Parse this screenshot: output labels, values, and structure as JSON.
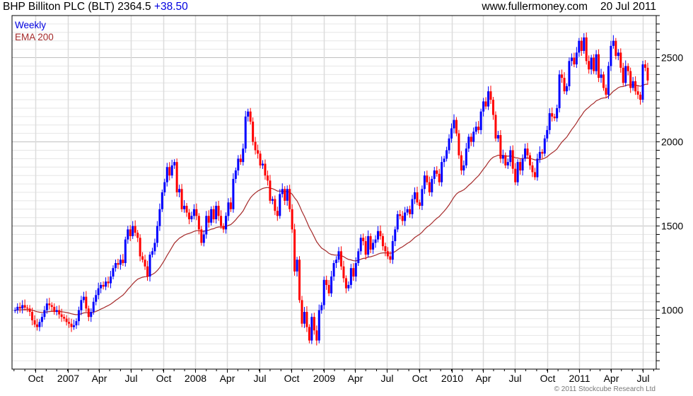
{
  "header": {
    "title": "BHP Billiton PLC (BLT) 2364.5",
    "change": "+38.50",
    "site": "www.fullermoney.com",
    "date": "20 Jul 2011"
  },
  "legend": {
    "period": "Weekly",
    "indicator": "EMA 200"
  },
  "footer": "© 2011 Stockcube Research Ltd",
  "colors": {
    "up": "#0000ff",
    "down": "#ff0000",
    "ema": "#a52a2a",
    "change": "#0000e0"
  },
  "chart_data": {
    "type": "candlestick",
    "title": "BHP Billiton PLC (BLT) 2364.5",
    "period": "Weekly",
    "overlay": "EMA 200",
    "ylim": [
      650,
      2750
    ],
    "y_ticks": [
      1000,
      1500,
      2000,
      2500
    ],
    "y_axis": "right",
    "grid": true,
    "x_ticks": [
      {
        "label": "Oct",
        "date": "2006-10-01"
      },
      {
        "label": "2007",
        "date": "2007-01-01"
      },
      {
        "label": "Apr",
        "date": "2007-04-01"
      },
      {
        "label": "Jul",
        "date": "2007-07-01"
      },
      {
        "label": "Oct",
        "date": "2007-10-01"
      },
      {
        "label": "2008",
        "date": "2008-01-01"
      },
      {
        "label": "Apr",
        "date": "2008-04-01"
      },
      {
        "label": "Jul",
        "date": "2008-07-01"
      },
      {
        "label": "Oct",
        "date": "2008-10-01"
      },
      {
        "label": "2009",
        "date": "2009-01-01"
      },
      {
        "label": "Apr",
        "date": "2009-04-01"
      },
      {
        "label": "Jul",
        "date": "2009-07-01"
      },
      {
        "label": "Oct",
        "date": "2009-10-01"
      },
      {
        "label": "2010",
        "date": "2010-01-01"
      },
      {
        "label": "Apr",
        "date": "2010-04-01"
      },
      {
        "label": "Jul",
        "date": "2010-07-01"
      },
      {
        "label": "Oct",
        "date": "2010-10-01"
      },
      {
        "label": "2011",
        "date": "2011-01-01"
      },
      {
        "label": "Apr",
        "date": "2011-04-01"
      },
      {
        "label": "Jul",
        "date": "2011-07-01"
      }
    ],
    "weekly_close": [
      [
        "2006-08-04",
        1000
      ],
      [
        "2006-08-11",
        1020
      ],
      [
        "2006-08-18",
        1010
      ],
      [
        "2006-08-25",
        1030
      ],
      [
        "2006-09-01",
        1015
      ],
      [
        "2006-09-08",
        1010
      ],
      [
        "2006-09-15",
        990
      ],
      [
        "2006-09-22",
        940
      ],
      [
        "2006-09-29",
        915
      ],
      [
        "2006-10-06",
        900
      ],
      [
        "2006-10-13",
        930
      ],
      [
        "2006-10-20",
        960
      ],
      [
        "2006-10-27",
        1000
      ],
      [
        "2006-11-03",
        1040
      ],
      [
        "2006-11-10",
        1030
      ],
      [
        "2006-11-17",
        1020
      ],
      [
        "2006-11-24",
        990
      ],
      [
        "2006-12-01",
        1000
      ],
      [
        "2006-12-08",
        975
      ],
      [
        "2006-12-15",
        960
      ],
      [
        "2006-12-22",
        950
      ],
      [
        "2006-12-29",
        930
      ],
      [
        "2007-01-05",
        920
      ],
      [
        "2007-01-12",
        900
      ],
      [
        "2007-01-19",
        910
      ],
      [
        "2007-01-26",
        935
      ],
      [
        "2007-02-02",
        1000
      ],
      [
        "2007-02-09",
        1060
      ],
      [
        "2007-02-16",
        1080
      ],
      [
        "2007-02-23",
        1010
      ],
      [
        "2007-03-02",
        960
      ],
      [
        "2007-03-09",
        990
      ],
      [
        "2007-03-16",
        1050
      ],
      [
        "2007-03-23",
        1090
      ],
      [
        "2007-03-30",
        1130
      ],
      [
        "2007-04-06",
        1150
      ],
      [
        "2007-04-13",
        1140
      ],
      [
        "2007-04-20",
        1170
      ],
      [
        "2007-04-27",
        1160
      ],
      [
        "2007-05-04",
        1200
      ],
      [
        "2007-05-11",
        1250
      ],
      [
        "2007-05-18",
        1280
      ],
      [
        "2007-05-25",
        1270
      ],
      [
        "2007-06-01",
        1300
      ],
      [
        "2007-06-08",
        1280
      ],
      [
        "2007-06-15",
        1420
      ],
      [
        "2007-06-22",
        1480
      ],
      [
        "2007-06-29",
        1440
      ],
      [
        "2007-07-06",
        1500
      ],
      [
        "2007-07-13",
        1460
      ],
      [
        "2007-07-20",
        1430
      ],
      [
        "2007-07-27",
        1320
      ],
      [
        "2007-08-03",
        1300
      ],
      [
        "2007-08-10",
        1260
      ],
      [
        "2007-08-17",
        1200
      ],
      [
        "2007-08-24",
        1330
      ],
      [
        "2007-08-31",
        1350
      ],
      [
        "2007-09-07",
        1400
      ],
      [
        "2007-09-14",
        1500
      ],
      [
        "2007-09-21",
        1600
      ],
      [
        "2007-09-28",
        1700
      ],
      [
        "2007-10-05",
        1760
      ],
      [
        "2007-10-12",
        1850
      ],
      [
        "2007-10-19",
        1800
      ],
      [
        "2007-10-26",
        1860
      ],
      [
        "2007-11-02",
        1880
      ],
      [
        "2007-11-09",
        1700
      ],
      [
        "2007-11-16",
        1720
      ],
      [
        "2007-11-23",
        1600
      ],
      [
        "2007-11-30",
        1620
      ],
      [
        "2007-12-07",
        1580
      ],
      [
        "2007-12-14",
        1540
      ],
      [
        "2007-12-21",
        1560
      ],
      [
        "2007-12-28",
        1600
      ],
      [
        "2008-01-04",
        1560
      ],
      [
        "2008-01-11",
        1480
      ],
      [
        "2008-01-18",
        1400
      ],
      [
        "2008-01-25",
        1450
      ],
      [
        "2008-02-01",
        1560
      ],
      [
        "2008-02-08",
        1520
      ],
      [
        "2008-02-15",
        1600
      ],
      [
        "2008-02-22",
        1540
      ],
      [
        "2008-02-29",
        1620
      ],
      [
        "2008-03-07",
        1560
      ],
      [
        "2008-03-14",
        1500
      ],
      [
        "2008-03-21",
        1480
      ],
      [
        "2008-03-28",
        1560
      ],
      [
        "2008-04-04",
        1640
      ],
      [
        "2008-04-11",
        1600
      ],
      [
        "2008-04-18",
        1780
      ],
      [
        "2008-04-25",
        1830
      ],
      [
        "2008-05-02",
        1900
      ],
      [
        "2008-05-09",
        1880
      ],
      [
        "2008-05-16",
        1960
      ],
      [
        "2008-05-23",
        2150
      ],
      [
        "2008-05-30",
        2180
      ],
      [
        "2008-06-06",
        2120
      ],
      [
        "2008-06-13",
        2000
      ],
      [
        "2008-06-20",
        1950
      ],
      [
        "2008-06-27",
        1930
      ],
      [
        "2008-07-04",
        1860
      ],
      [
        "2008-07-11",
        1870
      ],
      [
        "2008-07-18",
        1800
      ],
      [
        "2008-07-25",
        1770
      ],
      [
        "2008-08-01",
        1650
      ],
      [
        "2008-08-08",
        1660
      ],
      [
        "2008-08-15",
        1590
      ],
      [
        "2008-08-22",
        1560
      ],
      [
        "2008-08-29",
        1690
      ],
      [
        "2008-09-05",
        1720
      ],
      [
        "2008-09-12",
        1650
      ],
      [
        "2008-09-19",
        1720
      ],
      [
        "2008-09-26",
        1600
      ],
      [
        "2008-10-03",
        1480
      ],
      [
        "2008-10-10",
        1230
      ],
      [
        "2008-10-17",
        1300
      ],
      [
        "2008-10-24",
        1060
      ],
      [
        "2008-10-31",
        920
      ],
      [
        "2008-11-07",
        990
      ],
      [
        "2008-11-14",
        900
      ],
      [
        "2008-11-21",
        820
      ],
      [
        "2008-11-28",
        960
      ],
      [
        "2008-12-05",
        880
      ],
      [
        "2008-12-12",
        820
      ],
      [
        "2008-12-19",
        1000
      ],
      [
        "2008-12-26",
        1030
      ],
      [
        "2009-01-02",
        1180
      ],
      [
        "2009-01-09",
        1150
      ],
      [
        "2009-01-16",
        1100
      ],
      [
        "2009-01-23",
        1200
      ],
      [
        "2009-01-30",
        1280
      ],
      [
        "2009-02-06",
        1300
      ],
      [
        "2009-02-13",
        1350
      ],
      [
        "2009-02-20",
        1260
      ],
      [
        "2009-02-27",
        1190
      ],
      [
        "2009-03-06",
        1130
      ],
      [
        "2009-03-13",
        1150
      ],
      [
        "2009-03-20",
        1250
      ],
      [
        "2009-03-27",
        1200
      ],
      [
        "2009-04-03",
        1280
      ],
      [
        "2009-04-10",
        1350
      ],
      [
        "2009-04-17",
        1430
      ],
      [
        "2009-04-24",
        1410
      ],
      [
        "2009-05-01",
        1330
      ],
      [
        "2009-05-08",
        1440
      ],
      [
        "2009-05-15",
        1360
      ],
      [
        "2009-05-22",
        1400
      ],
      [
        "2009-05-29",
        1420
      ],
      [
        "2009-06-05",
        1470
      ],
      [
        "2009-06-12",
        1440
      ],
      [
        "2009-06-19",
        1380
      ],
      [
        "2009-06-26",
        1350
      ],
      [
        "2009-07-03",
        1320
      ],
      [
        "2009-07-10",
        1300
      ],
      [
        "2009-07-17",
        1410
      ],
      [
        "2009-07-24",
        1480
      ],
      [
        "2009-07-31",
        1570
      ],
      [
        "2009-08-07",
        1560
      ],
      [
        "2009-08-14",
        1530
      ],
      [
        "2009-08-21",
        1580
      ],
      [
        "2009-08-28",
        1600
      ],
      [
        "2009-09-04",
        1570
      ],
      [
        "2009-09-11",
        1660
      ],
      [
        "2009-09-18",
        1700
      ],
      [
        "2009-09-25",
        1640
      ],
      [
        "2009-10-02",
        1620
      ],
      [
        "2009-10-09",
        1720
      ],
      [
        "2009-10-16",
        1800
      ],
      [
        "2009-10-23",
        1760
      ],
      [
        "2009-10-30",
        1700
      ],
      [
        "2009-11-06",
        1780
      ],
      [
        "2009-11-13",
        1830
      ],
      [
        "2009-11-20",
        1810
      ],
      [
        "2009-11-27",
        1760
      ],
      [
        "2009-12-04",
        1880
      ],
      [
        "2009-12-11",
        1900
      ],
      [
        "2009-12-18",
        1950
      ],
      [
        "2009-12-25",
        2020
      ],
      [
        "2010-01-01",
        2080
      ],
      [
        "2010-01-08",
        2130
      ],
      [
        "2010-01-15",
        2050
      ],
      [
        "2010-01-22",
        1920
      ],
      [
        "2010-01-29",
        1830
      ],
      [
        "2010-02-05",
        1860
      ],
      [
        "2010-02-12",
        1960
      ],
      [
        "2010-02-19",
        2030
      ],
      [
        "2010-02-26",
        2000
      ],
      [
        "2010-03-05",
        2060
      ],
      [
        "2010-03-12",
        2090
      ],
      [
        "2010-03-19",
        2070
      ],
      [
        "2010-03-26",
        2180
      ],
      [
        "2010-04-02",
        2240
      ],
      [
        "2010-04-09",
        2210
      ],
      [
        "2010-04-16",
        2300
      ],
      [
        "2010-04-23",
        2250
      ],
      [
        "2010-04-30",
        2160
      ],
      [
        "2010-05-07",
        2020
      ],
      [
        "2010-05-14",
        2040
      ],
      [
        "2010-05-21",
        1900
      ],
      [
        "2010-05-28",
        1920
      ],
      [
        "2010-06-04",
        1860
      ],
      [
        "2010-06-11",
        1880
      ],
      [
        "2010-06-18",
        1950
      ],
      [
        "2010-06-25",
        1840
      ],
      [
        "2010-07-02",
        1760
      ],
      [
        "2010-07-09",
        1880
      ],
      [
        "2010-07-16",
        1830
      ],
      [
        "2010-07-23",
        1900
      ],
      [
        "2010-07-30",
        1960
      ],
      [
        "2010-08-06",
        1920
      ],
      [
        "2010-08-13",
        1860
      ],
      [
        "2010-08-20",
        1820
      ],
      [
        "2010-08-27",
        1790
      ],
      [
        "2010-09-03",
        1900
      ],
      [
        "2010-09-10",
        1940
      ],
      [
        "2010-09-17",
        1930
      ],
      [
        "2010-09-24",
        2020
      ],
      [
        "2010-10-01",
        2070
      ],
      [
        "2010-10-08",
        2170
      ],
      [
        "2010-10-15",
        2150
      ],
      [
        "2010-10-22",
        2140
      ],
      [
        "2010-10-29",
        2200
      ],
      [
        "2010-11-05",
        2400
      ],
      [
        "2010-11-12",
        2380
      ],
      [
        "2010-11-19",
        2300
      ],
      [
        "2010-11-26",
        2330
      ],
      [
        "2010-12-03",
        2480
      ],
      [
        "2010-12-10",
        2500
      ],
      [
        "2010-12-17",
        2460
      ],
      [
        "2010-12-24",
        2530
      ],
      [
        "2010-12-31",
        2600
      ],
      [
        "2011-01-07",
        2540
      ],
      [
        "2011-01-14",
        2620
      ],
      [
        "2011-01-21",
        2480
      ],
      [
        "2011-01-28",
        2430
      ],
      [
        "2011-02-04",
        2500
      ],
      [
        "2011-02-11",
        2420
      ],
      [
        "2011-02-18",
        2520
      ],
      [
        "2011-02-25",
        2380
      ],
      [
        "2011-03-04",
        2400
      ],
      [
        "2011-03-11",
        2320
      ],
      [
        "2011-03-18",
        2280
      ],
      [
        "2011-03-25",
        2450
      ],
      [
        "2011-04-01",
        2570
      ],
      [
        "2011-04-08",
        2600
      ],
      [
        "2011-04-15",
        2510
      ],
      [
        "2011-04-22",
        2530
      ],
      [
        "2011-04-29",
        2440
      ],
      [
        "2011-05-06",
        2350
      ],
      [
        "2011-05-13",
        2450
      ],
      [
        "2011-05-20",
        2420
      ],
      [
        "2011-05-27",
        2320
      ],
      [
        "2011-06-03",
        2360
      ],
      [
        "2011-06-10",
        2300
      ],
      [
        "2011-06-17",
        2280
      ],
      [
        "2011-06-24",
        2250
      ],
      [
        "2011-07-01",
        2460
      ],
      [
        "2011-07-08",
        2440
      ],
      [
        "2011-07-15",
        2364.5
      ]
    ]
  }
}
